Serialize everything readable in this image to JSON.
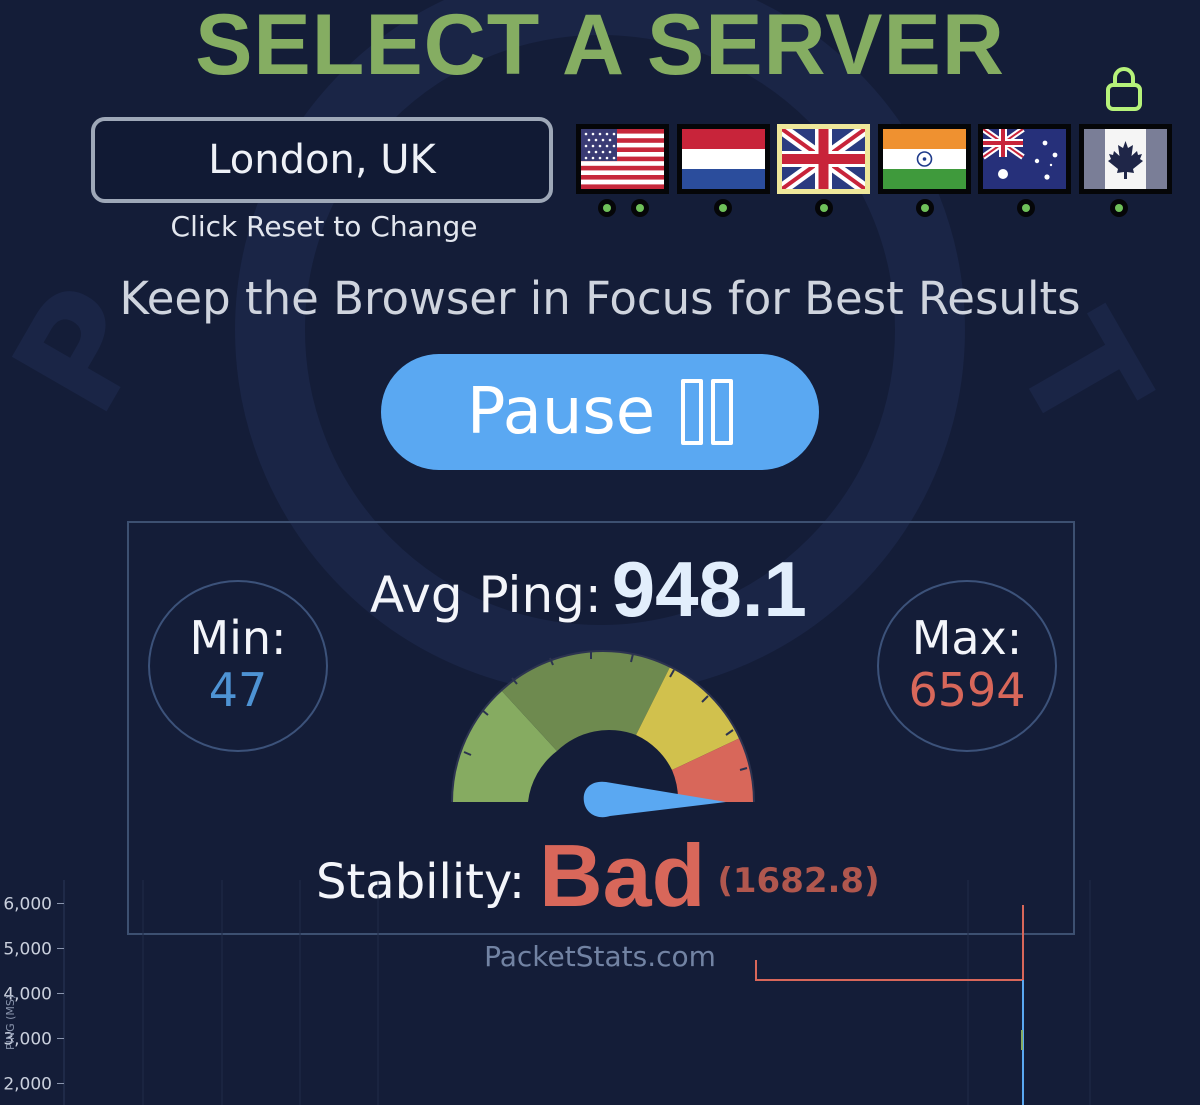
{
  "title": "SELECT A SERVER",
  "server": {
    "selected": "London, UK",
    "hint": "Click Reset to Change"
  },
  "focus_hint": "Keep the Browser in Focus for Best Results",
  "pause_label": "Pause",
  "stats": {
    "avg_label": "Avg Ping:",
    "avg_value": "948.1",
    "min_label": "Min:",
    "min_value": "47",
    "max_label": "Max:",
    "max_value": "6594",
    "stability_label": "Stability:",
    "stability_value": "Bad",
    "stability_score": "(1682.8)"
  },
  "site": "PacketStats.com",
  "colors": {
    "title": "#85ad62",
    "accent_blue": "#5aa8f2",
    "bad": "#d8675a",
    "min": "#4e93d4",
    "max": "#d8675a"
  },
  "icons": [
    "lock-icon",
    "pause-icon",
    "flag-us",
    "flag-nl",
    "flag-uk",
    "flag-in",
    "flag-au",
    "flag-ca"
  ],
  "chart_data": {
    "type": "line",
    "ylabel": "PING (MS)",
    "y_ticks": [
      "6,000",
      "5,000",
      "4,000",
      "3,000",
      "2,000"
    ],
    "ylim": [
      1500,
      6500
    ],
    "grid": true
  }
}
